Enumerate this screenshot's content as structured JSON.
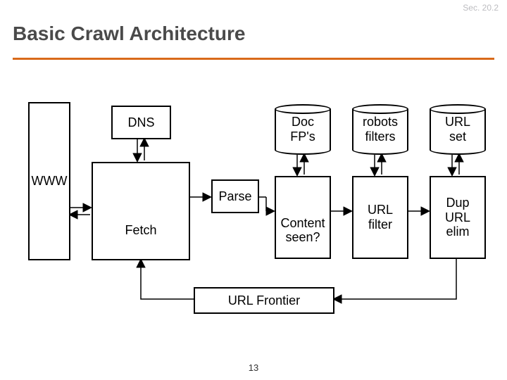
{
  "header": {
    "section_ref": "Sec. 20.2",
    "title": "Basic Crawl Architecture"
  },
  "boxes": {
    "www": "WWW",
    "dns": "DNS",
    "fetch": "Fetch",
    "parse": "Parse",
    "content_seen": "Content\nseen?",
    "url_filter": "URL\nfilter",
    "dup_url_elim": "Dup\nURL\nelim",
    "url_frontier": "URL Frontier"
  },
  "cylinders": {
    "doc_fps": "Doc\nFP's",
    "robots_filters": "robots\nfilters",
    "url_set": "URL\nset"
  },
  "page_number": "13"
}
